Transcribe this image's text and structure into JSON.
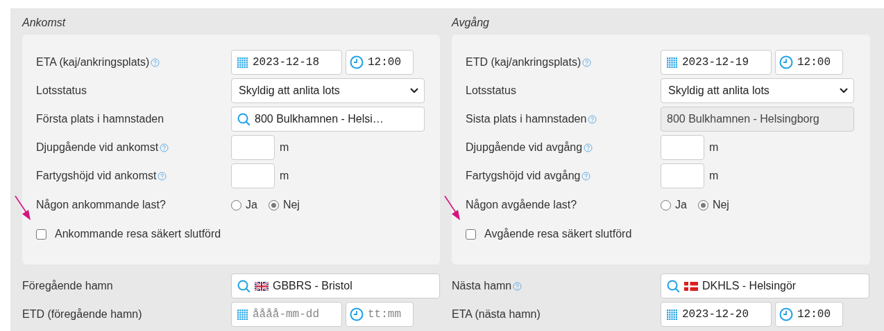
{
  "columns": [
    {
      "title": "Ankomst",
      "panel_rows": [
        {
          "kind": "datetime",
          "label": "ETA (kaj/ankringsplats)",
          "help": true,
          "date": {
            "value": "2023-12-18"
          },
          "time": {
            "value": "12:00"
          }
        },
        {
          "kind": "select",
          "label": "Lotsstatus",
          "help": false,
          "value": "Skyldig att anlita lots"
        },
        {
          "kind": "search",
          "label": "Första plats i hamnstaden",
          "help": false,
          "value": "800 Bulkhamnen - Helsi…"
        },
        {
          "kind": "number",
          "label": "Djupgående vid ankomst",
          "help": true,
          "unit": "m"
        },
        {
          "kind": "number",
          "label": "Fartygshöjd vid ankomst",
          "help": true,
          "unit": "m"
        },
        {
          "kind": "radio",
          "label": "Någon ankommande last?",
          "help": false,
          "options": [
            {
              "label": "Ja",
              "selected": false
            },
            {
              "label": "Nej",
              "selected": true
            }
          ]
        }
      ],
      "checkbox": {
        "label": "Ankommande resa säkert slutförd",
        "checked": false,
        "arrow": true
      },
      "after_rows": [
        {
          "kind": "search",
          "label": "Föregående hamn",
          "help": false,
          "flag": {
            "kind": "gb"
          },
          "value": "GBBRS - Bristol"
        },
        {
          "kind": "datetime",
          "label": "ETD (föregående hamn)",
          "help": false,
          "date": {
            "placeholder": "åååå-mm-dd"
          },
          "time": {
            "placeholder": "tt:mm"
          }
        }
      ]
    },
    {
      "title": "Avgång",
      "panel_rows": [
        {
          "kind": "datetime",
          "label": "ETD (kaj/ankringsplats)",
          "help": true,
          "date": {
            "value": "2023-12-19"
          },
          "time": {
            "value": "12:00"
          }
        },
        {
          "kind": "select",
          "label": "Lotsstatus",
          "help": false,
          "value": "Skyldig att anlita lots"
        },
        {
          "kind": "readonly",
          "label": "Sista plats i hamnstaden",
          "help": true,
          "value": "800 Bulkhamnen - Helsingborg"
        },
        {
          "kind": "number",
          "label": "Djupgående vid avgång",
          "help": true,
          "unit": "m"
        },
        {
          "kind": "number",
          "label": "Fartygshöjd vid avgång",
          "help": true,
          "unit": "m"
        },
        {
          "kind": "radio",
          "label": "Någon avgående last?",
          "help": false,
          "options": [
            {
              "label": "Ja",
              "selected": false
            },
            {
              "label": "Nej",
              "selected": true
            }
          ]
        }
      ],
      "checkbox": {
        "label": "Avgående resa säkert slutförd",
        "checked": false,
        "arrow": true
      },
      "after_rows": [
        {
          "kind": "search",
          "label": "Nästa hamn",
          "help": true,
          "flag": {
            "kind": "dk"
          },
          "value": "DKHLS - Helsingör"
        },
        {
          "kind": "datetime",
          "label": "ETA (nästa hamn)",
          "help": false,
          "date": {
            "value": "2023-12-20"
          },
          "time": {
            "value": "12:00"
          }
        }
      ]
    }
  ]
}
